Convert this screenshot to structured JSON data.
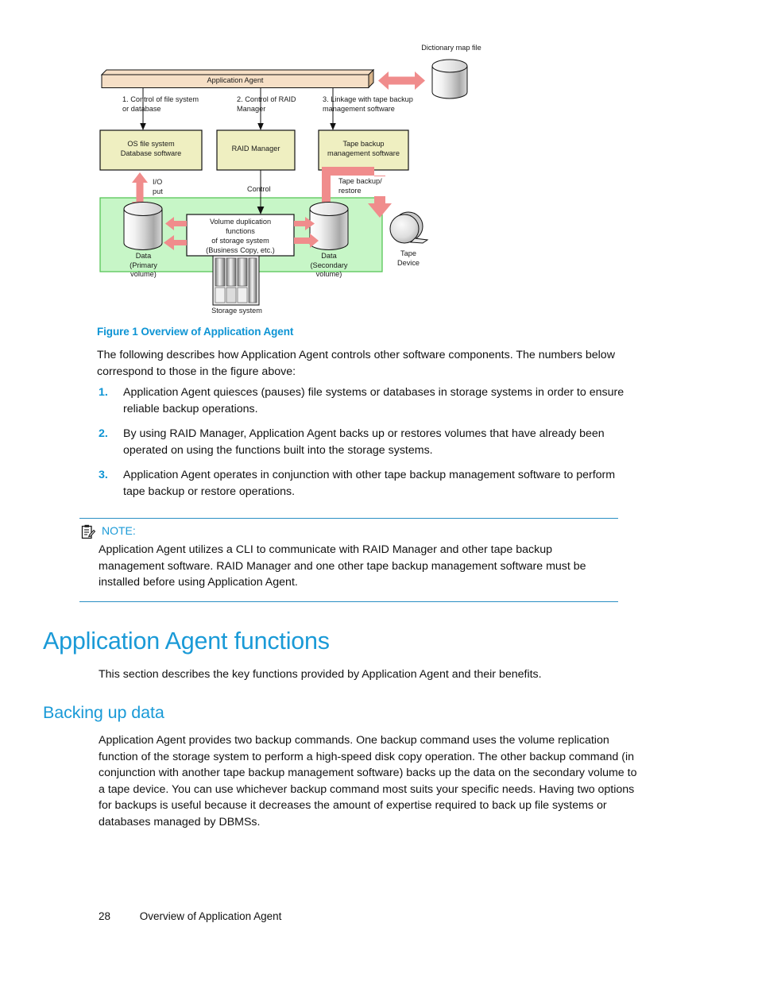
{
  "figure": {
    "caption": "Figure 1 Overview of Application Agent",
    "nodes": {
      "application_agent": "Application Agent",
      "dictionary_map_file": "Dictionary map file",
      "os_file_system": "OS file system\nDatabase software",
      "raid_manager": "RAID Manager",
      "tape_backup_software": "Tape backup\nmanagement software",
      "volume_duplication": "Volume duplication\nfunctions\nof  storage system\n(Business Copy, etc.)",
      "data_primary": "Data\n(Primary\nvolume)",
      "data_secondary": "Data\n(Secondary\nvolume)",
      "tape_device": "Tape\nDevice",
      "storage_system": "Storage system"
    },
    "connector_labels": {
      "link1": "1. Control of file system\nor database",
      "link2": "2. Control of RAID\nManager",
      "link3": "3. Linkage with tape backup\nmanagement software",
      "io": "I/O\nput",
      "control": "Control",
      "tape_backup_restore": "Tape backup/\nrestore"
    },
    "colors": {
      "agent_bar_fill": "#F6DFC6",
      "agent_bar_side": "#D8B48A",
      "box_fill": "#EFEFC1",
      "box_stroke": "#000000",
      "region_fill": "#C7F6C7",
      "region_stroke": "#4CC14C",
      "arrow_pink": "#F08C8C",
      "cylinder_light": "#FFFFFF",
      "cylinder_dark": "#9A9A9A"
    }
  },
  "body": {
    "intro": "The following describes how Application Agent controls other software components. The numbers below correspond to those in the figure above:",
    "numbered_items": [
      {
        "num": "1.",
        "text": "Application Agent quiesces (pauses) file systems or databases in storage systems in order to ensure reliable backup operations."
      },
      {
        "num": "2.",
        "text": "By using RAID Manager, Application Agent backs up or restores volumes that have already been operated on using the functions built into the storage systems."
      },
      {
        "num": "3.",
        "text": "Application Agent operates in conjunction with other tape backup management software to perform tape backup or restore operations."
      }
    ]
  },
  "note": {
    "icon": "note-clipboard-icon",
    "label": "NOTE:",
    "text": "Application Agent utilizes a CLI to communicate with RAID Manager and other tape backup management software. RAID Manager and one other tape backup management software must be installed before using Application Agent."
  },
  "sections": {
    "heading1": "Application Agent functions",
    "heading1_body": "This section describes the key functions provided by Application Agent and their benefits.",
    "heading2": "Backing up data",
    "heading2_body": "Application Agent provides two backup commands. One backup command uses the volume replication function of the storage system to perform a high-speed disk copy operation. The other backup command (in conjunction with another tape backup management software) backs up the data on the secondary volume to a tape device. You can use whichever backup command most suits your specific needs. Having two options for backups is useful because it decreases the amount of expertise required to back up file systems or databases managed by DBMSs."
  },
  "footer": {
    "page_number": "28",
    "chapter": "Overview of Application Agent"
  },
  "theme": {
    "accent_blue": "#1A9AD7",
    "text_black": "#111111"
  }
}
